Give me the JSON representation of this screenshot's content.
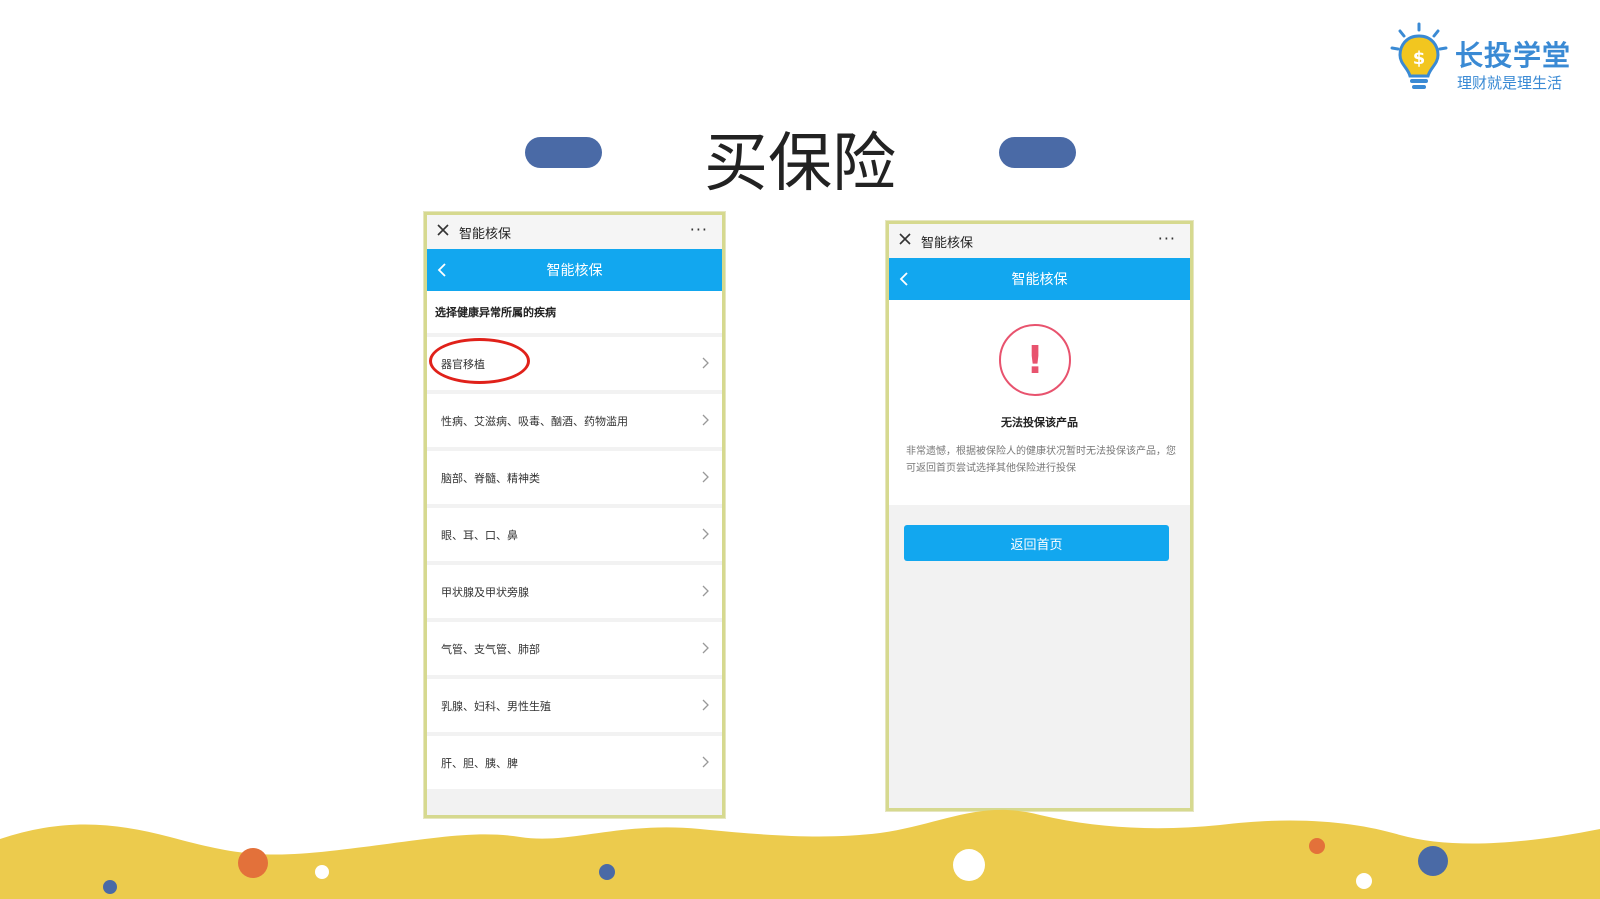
{
  "logo": {
    "name": "长投学堂",
    "slogan": "理财就是理生活",
    "icon": "lightbulb-dollar-icon",
    "color": "#3a8ad4"
  },
  "page": {
    "title": "买保险"
  },
  "left_phone": {
    "topbar": {
      "title": "智能核保",
      "close_icon": "close-icon",
      "more_icon": "more-dots-icon"
    },
    "navbar": {
      "title": "智能核保",
      "back_icon": "back-arrow-icon",
      "color": "#12a7ef"
    },
    "section_title": "选择健康异常所属的疾病",
    "items": [
      {
        "label": "器官移植",
        "highlighted": true
      },
      {
        "label": "性病、艾滋病、吸毒、酗酒、药物滥用"
      },
      {
        "label": "脑部、脊髓、精神类"
      },
      {
        "label": "眼、耳、口、鼻"
      },
      {
        "label": "甲状腺及甲状旁腺"
      },
      {
        "label": "气管、支气管、肺部"
      },
      {
        "label": "乳腺、妇科、男性生殖"
      },
      {
        "label": "肝、胆、胰、脾"
      }
    ]
  },
  "right_phone": {
    "topbar": {
      "title": "智能核保",
      "close_icon": "close-icon",
      "more_icon": "more-dots-icon"
    },
    "navbar": {
      "title": "智能核保",
      "back_icon": "back-arrow-icon"
    },
    "result": {
      "icon": "exclamation-warning-icon",
      "icon_color": "#e8536e",
      "title": "无法投保该产品",
      "description": "非常遗憾，根据被保险人的健康状况暂时无法投保该产品，您可返回首页尝试选择其他保险进行投保"
    },
    "home_button": "返回首页"
  },
  "colors": {
    "accent_pill": "#4a6aa6",
    "wave": "#eccb4d",
    "dot_orange": "#e3713a",
    "dot_blue": "#4a6aa6"
  }
}
